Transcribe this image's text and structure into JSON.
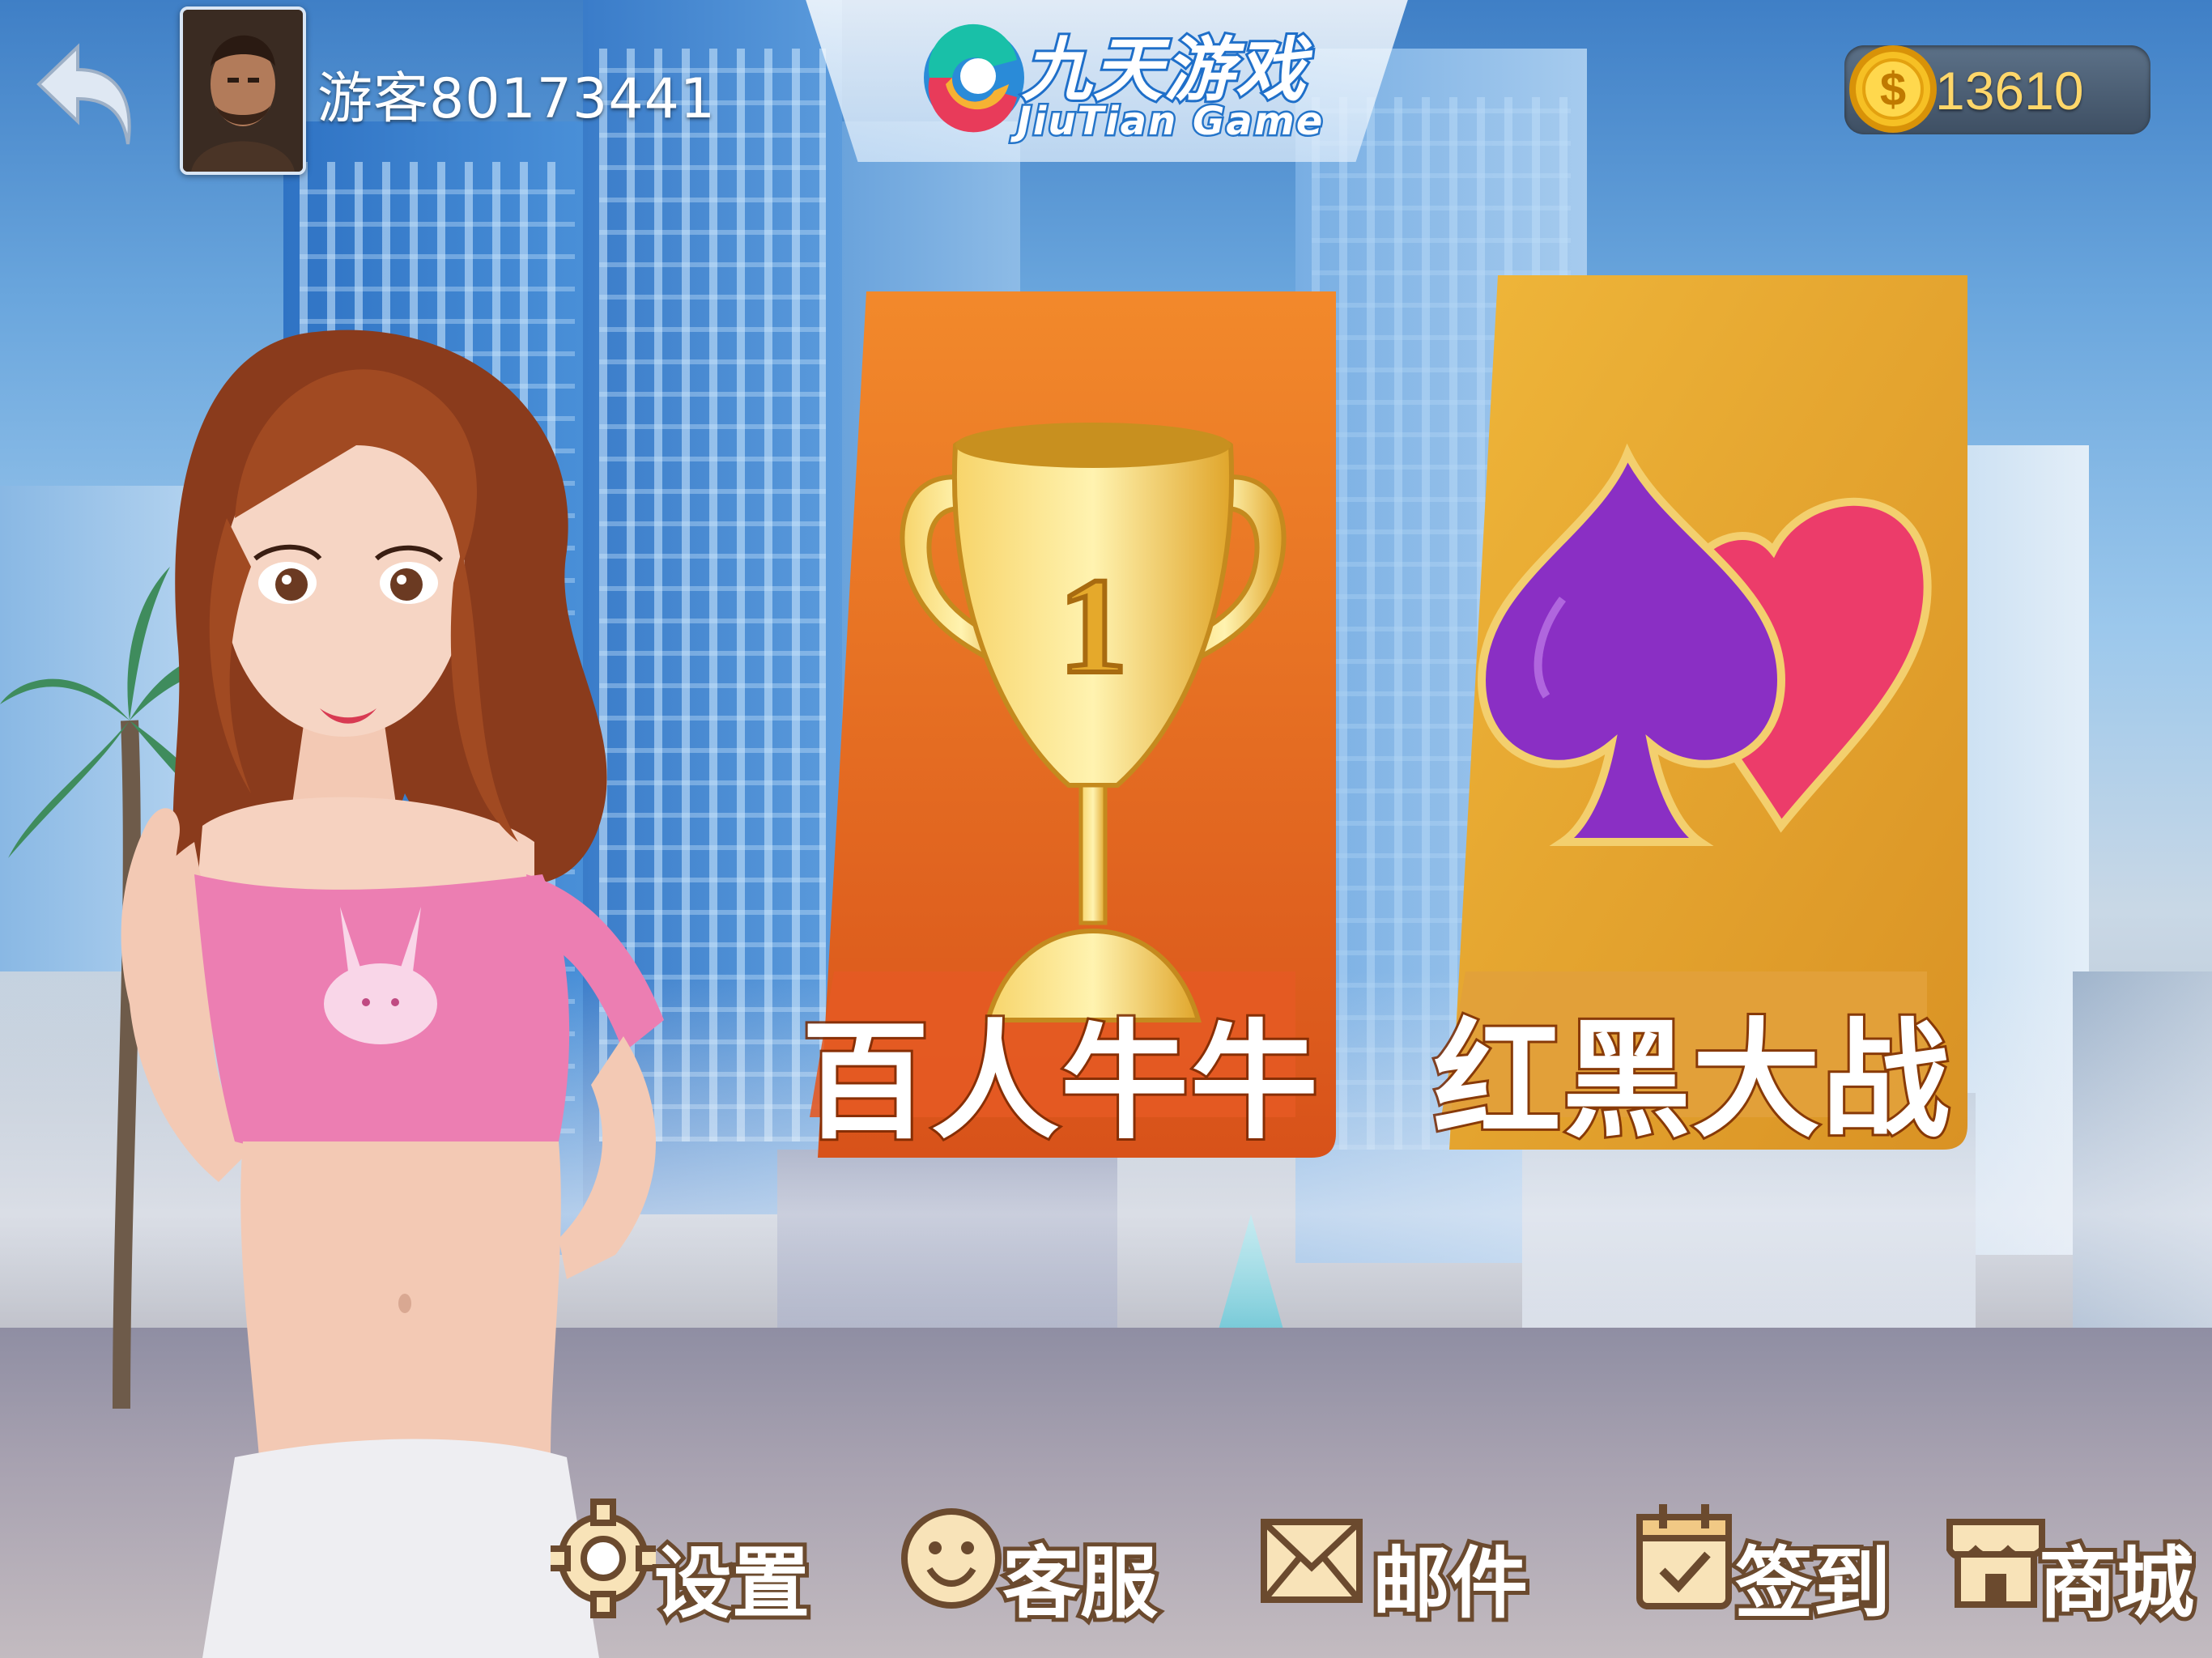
{
  "header": {
    "username": "游客80173441",
    "logo_cn": "九天游戏",
    "logo_en": "JiuTian Game",
    "coins": "13610"
  },
  "games": [
    {
      "label": "百人牛牛",
      "icon": "trophy-icon",
      "color": "#e2691b"
    },
    {
      "label": "红黑大战",
      "icon": "spade-heart-icon",
      "color": "#e8a62a"
    }
  ],
  "menu": [
    {
      "label": "设置",
      "icon": "gear-icon"
    },
    {
      "label": "客服",
      "icon": "smile-icon"
    },
    {
      "label": "邮件",
      "icon": "envelope-icon"
    },
    {
      "label": "签到",
      "icon": "calendar-check-icon"
    },
    {
      "label": "商城",
      "icon": "shop-icon"
    }
  ],
  "colors": {
    "menu_text_stroke": "#6b4a2e",
    "coin": "#f6b819",
    "card_orange": "#e2691b",
    "card_gold": "#e8a62a"
  }
}
